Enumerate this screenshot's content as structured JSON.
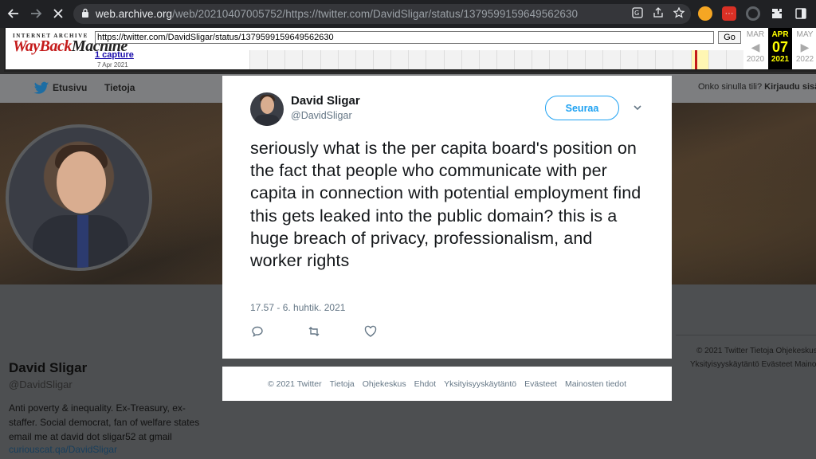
{
  "browser": {
    "url_host": "web.archive.org",
    "url_path": "/web/20210407005752/https://twitter.com/DavidSligar/status/1379599159649562630"
  },
  "wayback": {
    "logo_top": "INTERNET ARCHIVE",
    "logo_main": "WayBack",
    "logo_machine": "Machine",
    "url_value": "https://twitter.com/DavidSligar/status/1379599159649562630",
    "go_label": "Go",
    "captures": "1 capture",
    "capture_date": "7 Apr 2021",
    "prev_month": "MAR",
    "prev_year": "2020",
    "cur_month": "APR",
    "cur_day": "07",
    "cur_year": "2021",
    "next_month": "MAY",
    "next_year": "2022"
  },
  "twitter_nav": {
    "home": "Etusivu",
    "about": "Tietoja",
    "account_q": "Onko sinulla tili?",
    "login": "Kirjaudu sisään"
  },
  "profile": {
    "name": "David Sligar",
    "handle": "@DavidSligar",
    "bio": "Anti poverty & inequality. Ex-Treasury, ex-staffer. Social democrat, fan of welfare states email me at david dot sligar52 at gmail",
    "link": "curiouscat.qa/DavidSligar",
    "footer_line1": "© 2021 Twitter   Tietoja   Ohjekeskus",
    "footer_line2": "Yksityisyyskäytäntö   Evästeet   Mainosten tiedot"
  },
  "tweet": {
    "name": "David Sligar",
    "handle": "@DavidSligar",
    "follow_label": "Seuraa",
    "text": "seriously what is the per capita board's position on the fact that people who communicate with per capita in connection with potential employment find this gets leaked into the public domain? this is a huge breach of privacy, professionalism, and worker rights",
    "timestamp": "17.57 - 6. huhtik. 2021"
  },
  "modal_footer": {
    "copyright": "© 2021 Twitter",
    "about": "Tietoja",
    "help": "Ohjekeskus",
    "terms": "Ehdot",
    "privacy": "Yksityisyyskäytäntö",
    "cookies": "Evästeet",
    "ads": "Mainosten tiedot"
  },
  "colors": {
    "twitter_blue": "#1da1f2",
    "wayback_red": "#c41a1a",
    "chrome_dark": "#202124"
  }
}
